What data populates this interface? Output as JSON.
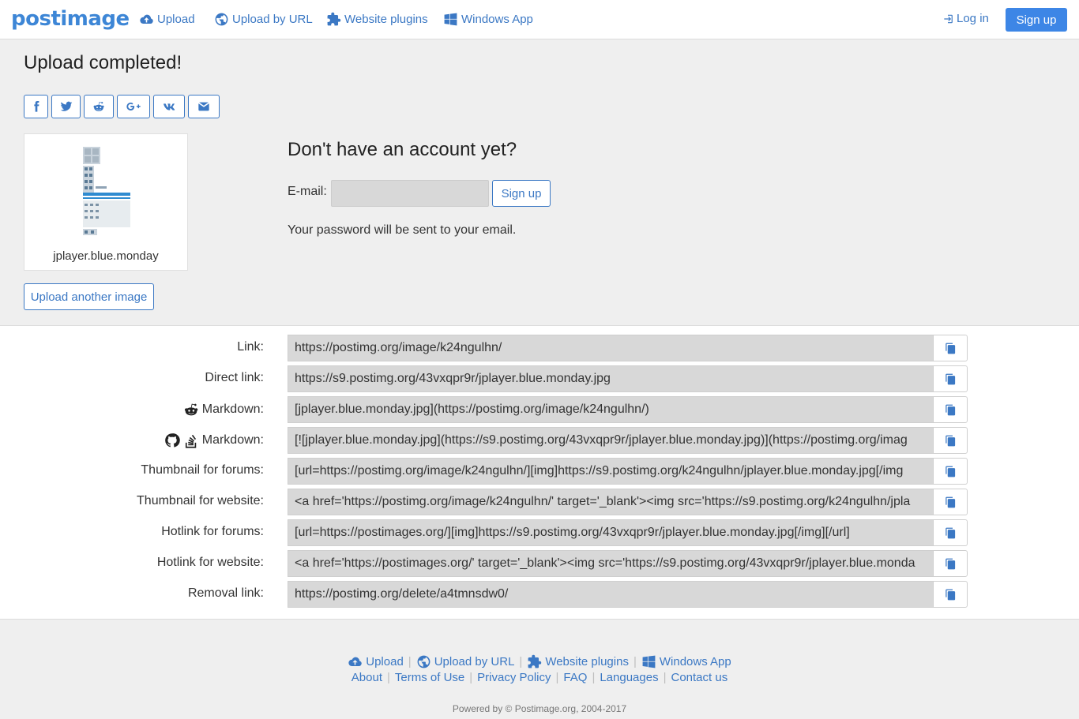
{
  "brand": {
    "logo_text": "postimage",
    "accent_color": "#3d86e6"
  },
  "nav": {
    "items": [
      {
        "label": "Upload",
        "icon": "cloud-upload-icon"
      },
      {
        "label": "Upload by URL",
        "icon": "globe-icon"
      },
      {
        "label": "Website plugins",
        "icon": "puzzle-icon"
      },
      {
        "label": "Windows App",
        "icon": "windows-icon"
      }
    ],
    "login_label": "Log in",
    "signup_label": "Sign up"
  },
  "upload": {
    "title": "Upload completed!",
    "share_buttons": [
      "facebook-icon",
      "twitter-icon",
      "reddit-icon",
      "google-plus-icon",
      "vk-icon",
      "envelope-icon"
    ],
    "thumbnail_caption": "jplayer.blue.monday",
    "upload_another_label": "Upload another image"
  },
  "account": {
    "title": "Don't have an account yet?",
    "email_label": "E-mail:",
    "email_value": "",
    "signup_label": "Sign up",
    "password_note": "Your password will be sent to your email."
  },
  "links": [
    {
      "label": "Link:",
      "value": "https://postimg.org/image/k24ngulhn/"
    },
    {
      "label": "Direct link:",
      "value": "https://s9.postimg.org/43vxqpr9r/jplayer.blue.monday.jpg"
    },
    {
      "label": "Markdown:",
      "icons": [
        "reddit-icon"
      ],
      "value": "[jplayer.blue.monday.jpg](https://postimg.org/image/k24ngulhn/)"
    },
    {
      "label": "Markdown:",
      "icons": [
        "github-icon",
        "stackoverflow-icon"
      ],
      "value": "[![jplayer.blue.monday.jpg](https://s9.postimg.org/43vxqpr9r/jplayer.blue.monday.jpg)](https://postimg.org/imag"
    },
    {
      "label": "Thumbnail for forums:",
      "value": "[url=https://postimg.org/image/k24ngulhn/][img]https://s9.postimg.org/k24ngulhn/jplayer.blue.monday.jpg[/img"
    },
    {
      "label": "Thumbnail for website:",
      "value": "<a href='https://postimg.org/image/k24ngulhn/' target='_blank'><img src='https://s9.postimg.org/k24ngulhn/jpla"
    },
    {
      "label": "Hotlink for forums:",
      "value": "[url=https://postimages.org/][img]https://s9.postimg.org/43vxqpr9r/jplayer.blue.monday.jpg[/img][/url]"
    },
    {
      "label": "Hotlink for website:",
      "value": "<a href='https://postimages.org/' target='_blank'><img src='https://s9.postimg.org/43vxqpr9r/jplayer.blue.monda"
    },
    {
      "label": "Removal link:",
      "value": "https://postimg.org/delete/a4tmnsdw0/"
    }
  ],
  "footer": {
    "row1": [
      "Upload",
      "Upload by URL",
      "Website plugins",
      "Windows App"
    ],
    "row2": [
      "About",
      "Terms of Use",
      "Privacy Policy",
      "FAQ",
      "Languages",
      "Contact us"
    ],
    "powered_by": "Powered by © Postimage.org, 2004-2017"
  }
}
